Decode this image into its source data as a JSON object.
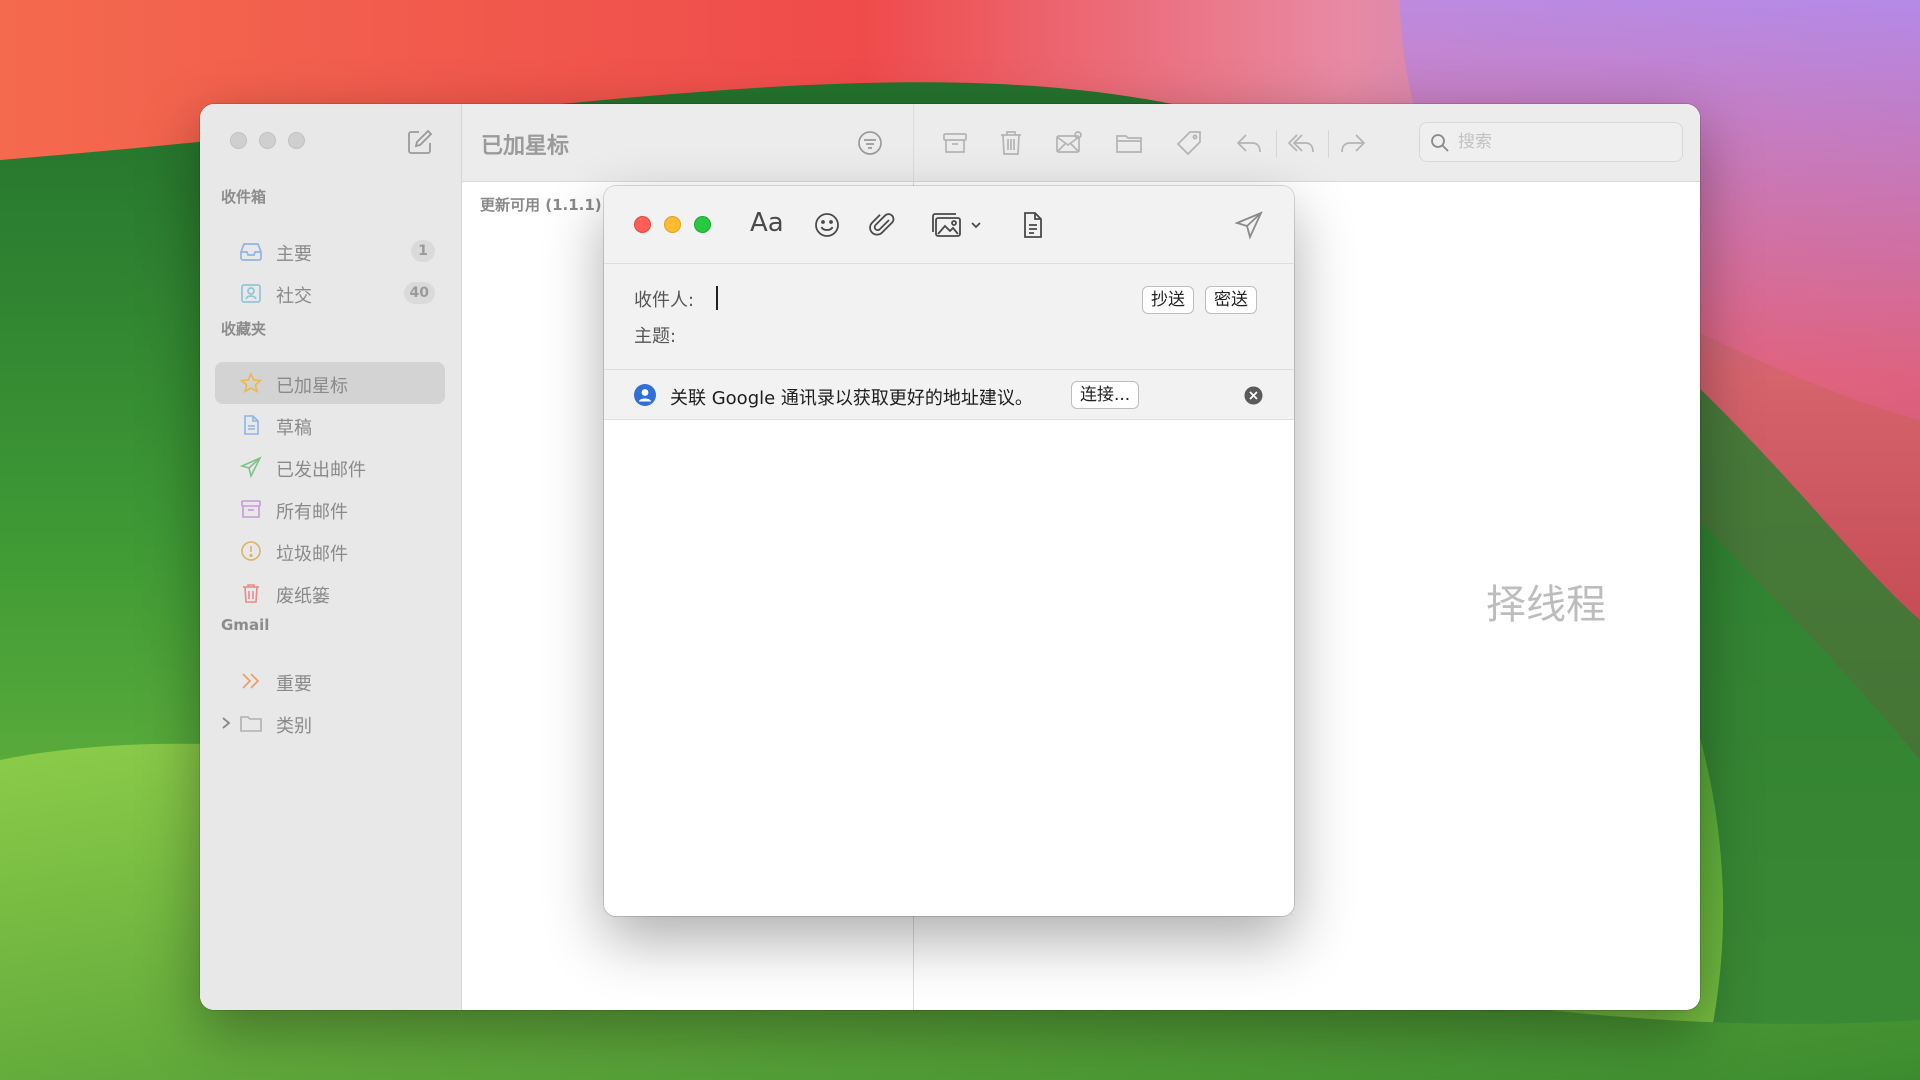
{
  "sidebar": {
    "sections": {
      "inbox": "收件箱",
      "favorites": "收藏夹",
      "gmail": "Gmail"
    },
    "inbox_items": [
      {
        "label": "主要",
        "count": "1"
      },
      {
        "label": "社交",
        "count": "40"
      }
    ],
    "favorite_items": [
      {
        "label": "已加星标"
      },
      {
        "label": "草稿"
      },
      {
        "label": "已发出邮件"
      },
      {
        "label": "所有邮件"
      },
      {
        "label": "垃圾邮件"
      },
      {
        "label": "废纸篓"
      }
    ],
    "gmail_items": [
      {
        "label": "重要"
      },
      {
        "label": "类别"
      }
    ]
  },
  "message_list": {
    "title": "已加星标",
    "update_banner": "更新可用 (1.1.1)"
  },
  "viewer": {
    "empty_text": "择线程"
  },
  "search": {
    "placeholder": "搜索"
  },
  "compose": {
    "format_label": "Aa",
    "to_label": "收件人:",
    "subject_label": "主题:",
    "cc_label": "抄送",
    "bcc_label": "密送",
    "suggestion_text": "关联 Google 通讯录以获取更好的地址建议。",
    "connect_label": "连接..."
  },
  "icons": {
    "compose": "compose-icon",
    "filter": "filter-icon",
    "archive": "archive-icon",
    "trash": "trash-icon",
    "junk": "junk-mail-icon",
    "move": "folder-icon",
    "tag": "tag-icon",
    "reply": "reply-icon",
    "reply_all": "reply-all-icon",
    "forward": "forward-icon",
    "search": "search-icon",
    "emoji": "emoji-icon",
    "attach": "paperclip-icon",
    "photo": "photo-browser-icon",
    "template": "document-icon",
    "send": "send-icon"
  },
  "colors": {
    "accent_blue": "#2f6fd6",
    "close_red": "#ff5f57",
    "minimize_yellow": "#febc2e",
    "zoom_green": "#28c840"
  }
}
